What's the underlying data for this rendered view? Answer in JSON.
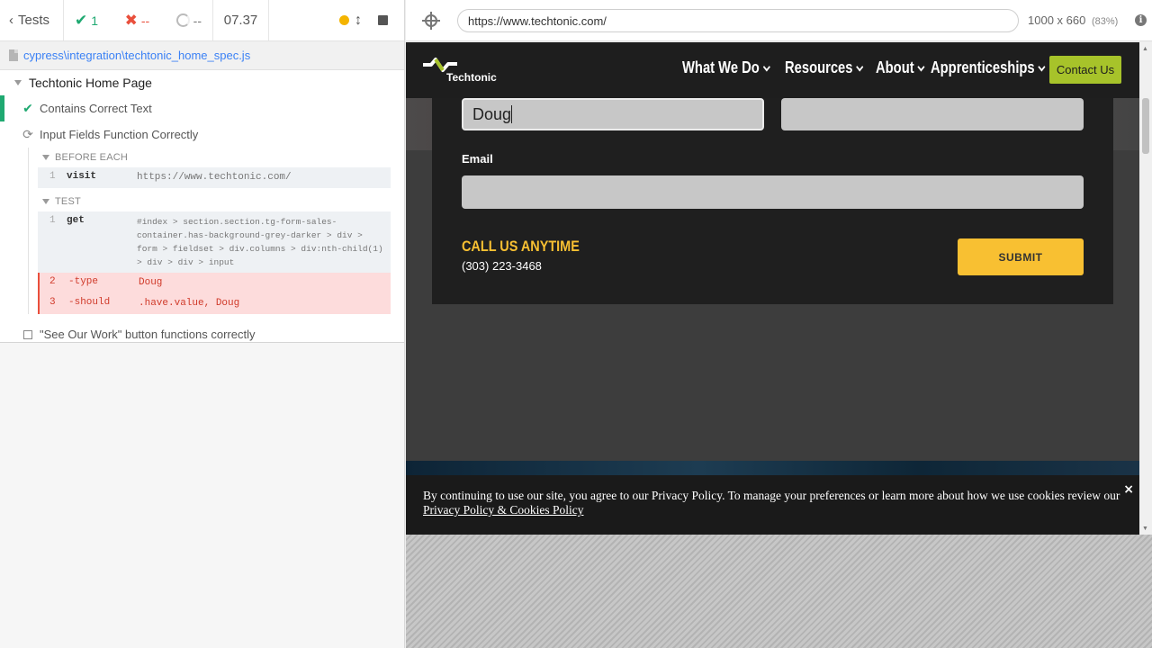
{
  "reporter": {
    "tests_label": "Tests",
    "stats": {
      "passed": "1",
      "failed": "--",
      "pending": "--"
    },
    "duration": "07.37",
    "spec_path": "cypress\\integration\\techtonic_home_spec.js",
    "suite_title": "Techtonic Home Page",
    "tests": [
      {
        "title": "Contains Correct Text",
        "state": "passed"
      },
      {
        "title": "Input Fields Function Correctly",
        "state": "running"
      },
      {
        "title": "\"See Our Work\" button functions correctly",
        "state": "pending"
      }
    ],
    "hooks": {
      "before_each": {
        "title": "BEFORE EACH",
        "commands": [
          {
            "num": "1",
            "name": "visit",
            "message": "https://www.techtonic.com/"
          }
        ]
      },
      "test": {
        "title": "TEST",
        "commands": [
          {
            "num": "1",
            "name": "get",
            "message": "#index > section.section.tg-form-sales-container.has-background-grey-darker > div > form > fieldset > div.columns > div:nth-child(1) > div > div > input"
          },
          {
            "num": "2",
            "name": "-type",
            "message": "Doug"
          },
          {
            "num": "3",
            "name": "-should",
            "message": ".have.value, Doug"
          }
        ]
      }
    }
  },
  "aut_header": {
    "url": "https://www.techtonic.com/",
    "viewport": "1000 x 660",
    "scale": "(83%)"
  },
  "site": {
    "logo_text": "Techtonic",
    "nav": [
      "What We Do",
      "Resources",
      "About",
      "Apprenticeships"
    ],
    "contact_button": "Contact Us",
    "form": {
      "first_name_value": "Doug",
      "last_name_value": "",
      "email_label": "Email",
      "email_value": "",
      "call_title": "CALL US ANYTIME",
      "phone": "(303) 223-3468",
      "submit": "SUBMIT"
    },
    "cookie": {
      "text": "By continuing to use our site, you agree to our Privacy Policy. To manage your preferences or learn more about how we use cookies review our ",
      "link": "Privacy Policy & Cookies Policy",
      "close": "×"
    }
  },
  "colors": {
    "pass": "#1fa971",
    "fail": "#e94f3c",
    "link": "#3b81f5",
    "accent_green": "#a7c32a",
    "accent_yellow": "#f8c032"
  }
}
